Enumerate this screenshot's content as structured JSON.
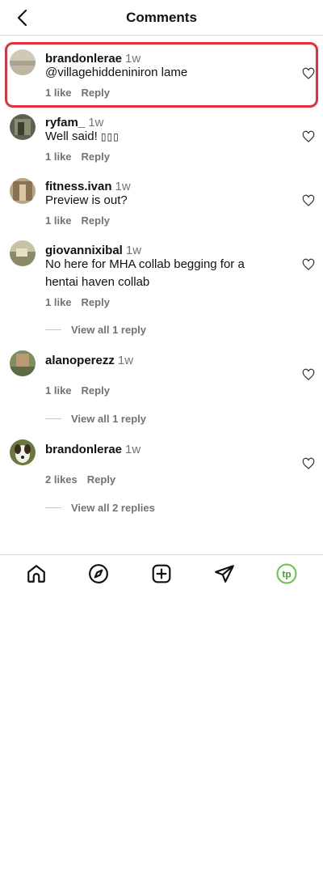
{
  "header": {
    "title": "Comments"
  },
  "comments": [
    {
      "username": "brandonlerae",
      "time": "1w",
      "text": "@villagehiddeniniron lame",
      "likes": "1 like",
      "reply": "Reply"
    },
    {
      "username": "ryfam_",
      "time": "1w",
      "text": "Well said! ",
      "likes": "1 like",
      "reply": "Reply"
    },
    {
      "username": "fitness.ivan",
      "time": "1w",
      "text": "Preview is out?",
      "likes": "1 like",
      "reply": "Reply"
    },
    {
      "username": "giovannixibal",
      "time": "1w",
      "text": "No here for MHA collab begging for a hentai haven collab",
      "likes": "1 like",
      "reply": "Reply",
      "view_replies": "View all 1 reply"
    },
    {
      "username": "alanoperezz",
      "time": "1w",
      "text": "",
      "likes": "1 like",
      "reply": "Reply",
      "view_replies": "View all 1 reply"
    },
    {
      "username": "brandonlerae",
      "time": "1w",
      "text": "",
      "likes": "2 likes",
      "reply": "Reply",
      "view_replies": "View all 2 replies"
    }
  ],
  "tabbar": {
    "items": [
      "home-icon",
      "explore-icon",
      "new-post-icon",
      "direct-icon",
      "profile-icon"
    ],
    "profile_initials": "tp"
  },
  "colors": {
    "highlight": "#e0313f",
    "profile_accent": "#6cc24a"
  }
}
